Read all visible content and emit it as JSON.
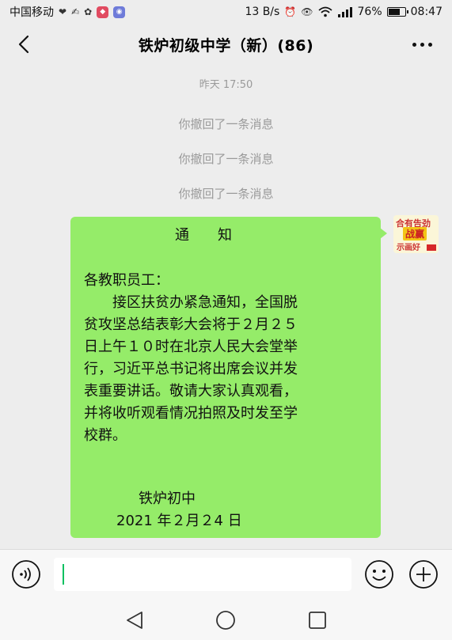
{
  "status_bar": {
    "carrier": "中国移动",
    "speed": "13 B/s",
    "battery": "76%",
    "battery_level": 0.76,
    "time": "08:47"
  },
  "header": {
    "title": "铁炉初级中学（新）(86)"
  },
  "chat": {
    "timestamp": "昨天 17:50",
    "recalls": [
      "你撤回了一条消息",
      "你撤回了一条消息",
      "你撤回了一条消息"
    ],
    "message_lines": [
      "通　　知",
      "各教职员工：",
      "　　接区扶贫办紧急通知，全国脱",
      "贫攻坚总结表彰大会将于２月２５",
      "日上午１０时在北京人民大会堂举",
      "行，习近平总书记将出席会议并发",
      "表重要讲话。敬请大家认真观看，",
      "并将收听观看情况拍照及时发至学",
      "校群。",
      "铁炉初中",
      "2021 年２月２4 日"
    ],
    "avatar_text": [
      "合有告劲",
      "战赢",
      "示画好"
    ]
  },
  "colors": {
    "bubble": "#95ec69",
    "background": "#ededed",
    "caret": "#07c160"
  }
}
